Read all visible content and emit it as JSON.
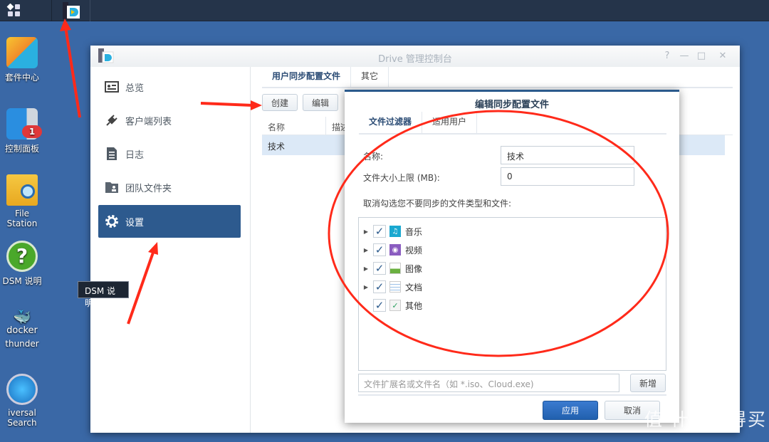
{
  "taskbar": {
    "main_menu_icon": "grid-icon",
    "pinned_app_icon": "drive-app-icon"
  },
  "desktop": {
    "icons": [
      {
        "label": "套件中心",
        "icon": "package-center-icon"
      },
      {
        "label": "控制面板",
        "icon": "control-panel-icon",
        "badge": "1"
      },
      {
        "label": "File Station",
        "icon": "file-station-icon"
      },
      {
        "label": "DSM 说明",
        "icon": "help-icon"
      },
      {
        "label": "thunder",
        "icon": "docker-icon",
        "sublabel": "docker"
      },
      {
        "label": "iversal Search",
        "icon": "universal-search-icon"
      }
    ],
    "tooltip": "DSM 说明"
  },
  "window": {
    "title": "Drive 管理控制台",
    "sidebar": [
      {
        "label": "总览",
        "icon": "overview-icon"
      },
      {
        "label": "客户端列表",
        "icon": "plug-icon"
      },
      {
        "label": "日志",
        "icon": "log-icon"
      },
      {
        "label": "团队文件夹",
        "icon": "team-folder-icon"
      },
      {
        "label": "设置",
        "icon": "gear-icon",
        "active": true
      }
    ],
    "tabs": [
      "用户同步配置文件",
      "其它"
    ],
    "toolbar": {
      "create": "创建",
      "edit": "编辑"
    },
    "grid": {
      "columns": [
        "名称",
        "描述"
      ],
      "rows": [
        [
          "技术"
        ]
      ]
    }
  },
  "dialog": {
    "title": "编辑同步配置文件",
    "tabs": [
      "文件过滤器",
      "适用用户"
    ],
    "name_label": "名称:",
    "name_value": "技术",
    "size_label": "文件大小上限 (MB):",
    "size_value": "0",
    "instruction": "取消勾选您不要同步的文件类型和文件:",
    "file_types": [
      {
        "label": "音乐",
        "checked": true,
        "expandable": true,
        "icon": "music-icon",
        "color": "#1aa8d0"
      },
      {
        "label": "视频",
        "checked": true,
        "expandable": true,
        "icon": "video-icon",
        "color": "#8a5cc0"
      },
      {
        "label": "图像",
        "checked": true,
        "expandable": true,
        "icon": "image-icon",
        "color": "#6bb040"
      },
      {
        "label": "文档",
        "checked": true,
        "expandable": true,
        "icon": "document-icon",
        "color": "#6a9ad0"
      },
      {
        "label": "其他",
        "checked": true,
        "expandable": false,
        "icon": "other-file-icon",
        "color": "#2aa060"
      }
    ],
    "ext_placeholder": "文件扩展名或文件名（如 *.iso、Cloud.exe)",
    "add": "新增",
    "apply": "应用",
    "cancel": "取消"
  },
  "watermark": "值 什么值得买",
  "colors": {
    "desktop": "#3a68a6",
    "accent": "#2d5a8e",
    "annotation": "#ff2a1a"
  }
}
